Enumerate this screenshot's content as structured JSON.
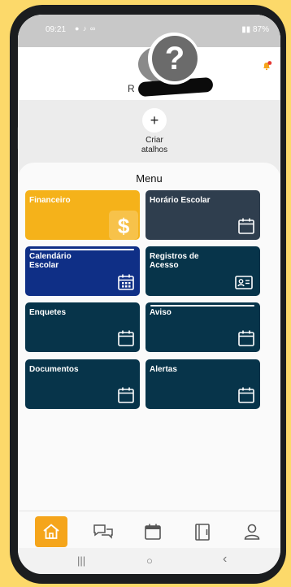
{
  "status_bar": {
    "time": "09:21",
    "battery": "87%"
  },
  "header": {
    "user_initial": "R",
    "user_name_redacted": "",
    "notification_dot_color": "#e53935"
  },
  "shortcuts": {
    "add_label_line1": "Criar",
    "add_label_line2": "atalhos",
    "add_symbol": "+"
  },
  "menu": {
    "title": "Menu",
    "tiles": [
      {
        "label": "Financeiro",
        "color": "#f5b21a",
        "icon": "dollar-icon"
      },
      {
        "label": "Horário Escolar",
        "color": "#2f3e4e",
        "icon": "calendar-icon"
      },
      {
        "label": "Calendário Escolar",
        "color": "#0f2f86",
        "icon": "calendar-grid-icon"
      },
      {
        "label": "Registros de Acesso",
        "color": "#07344a",
        "icon": "id-card-icon"
      },
      {
        "label": "Enquetes",
        "color": "#07344a",
        "icon": "calendar-icon"
      },
      {
        "label": "Aviso",
        "color": "#07344a",
        "icon": "calendar-icon"
      },
      {
        "label": "Documentos",
        "color": "#07344a",
        "icon": "calendar-icon"
      },
      {
        "label": "Alertas",
        "color": "#07344a",
        "icon": "calendar-icon"
      }
    ]
  },
  "bottom_nav": {
    "items": [
      "home-icon",
      "chat-icon",
      "calendar-icon",
      "book-icon",
      "user-icon"
    ],
    "active_color": "#f5a51b"
  },
  "system_nav": {
    "recents": "|||",
    "home": "○",
    "back": "‹"
  }
}
